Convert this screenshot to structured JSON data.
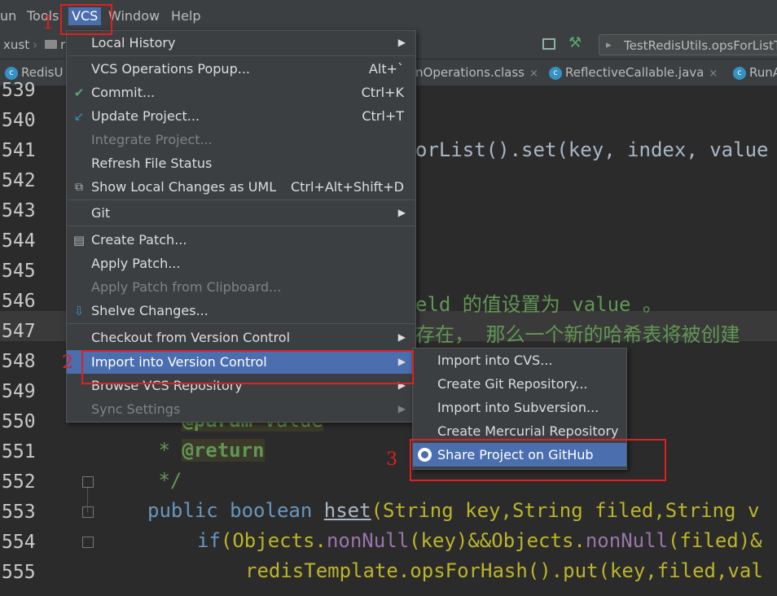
{
  "menubar": {
    "items": [
      "un",
      "Tools",
      "VCS",
      "Window",
      "Help"
    ]
  },
  "navbar": {
    "crumbs": [
      "xust",
      "r"
    ],
    "run_config": "TestRedisUtils.opsForListT"
  },
  "tabs": [
    {
      "label": "RedisU",
      "close": ""
    },
    {
      "label": "nOperations.class",
      "close": "×"
    },
    {
      "label": "ReflectiveCallable.java",
      "close": "×"
    },
    {
      "label": "RunA",
      "close": ""
    }
  ],
  "editor": {
    "line_numbers": [
      "539",
      "540",
      "541",
      "542",
      "543",
      "544",
      "545",
      "546",
      "547",
      "548",
      "549",
      "550",
      "551",
      "552",
      "553",
      "554",
      "555"
    ],
    "code": {
      "l541": "orList().set(key, index, value",
      "l546a": "eld ",
      "l546b": "的值设置为 ",
      "l546c": "value ",
      "l546d": "。",
      "l547": "存在， 那么一个新的哈希表将被创建",
      "l550_star": " * ",
      "l550_tag": "@param",
      "l550_val": " value",
      "l551_star": " * ",
      "l551_tag": "@return",
      "l552": " */",
      "l553_kw1": "public",
      "l553_kw2": "boolean",
      "l553_m": "hset",
      "l553_rest": "(String key,String filed,String v",
      "l554_kw": "if",
      "l554_rest1": "(Objects.",
      "l554_m1": "nonNull",
      "l554_rest2": "(key)&&Objects.",
      "l554_m2": "nonNull",
      "l554_rest3": "(filed)&",
      "l555_f": "redisTemplate",
      "l555_rest": ".opsForHash().put(key,filed,val"
    }
  },
  "vcs_menu": {
    "items": [
      {
        "label": "Local History",
        "shortcut": "",
        "arrow": true,
        "disabled": false,
        "icon": ""
      },
      {
        "label": "VCS Operations Popup...",
        "shortcut": "Alt+`",
        "arrow": false,
        "disabled": false,
        "icon": ""
      },
      {
        "label": "Commit...",
        "shortcut": "Ctrl+K",
        "arrow": false,
        "disabled": false,
        "icon": "check-icon"
      },
      {
        "label": "Update Project...",
        "shortcut": "Ctrl+T",
        "arrow": false,
        "disabled": false,
        "icon": "update-arrow-icon"
      },
      {
        "label": "Integrate Project...",
        "shortcut": "",
        "arrow": false,
        "disabled": true,
        "icon": ""
      },
      {
        "label": "Refresh File Status",
        "shortcut": "",
        "arrow": false,
        "disabled": false,
        "icon": ""
      },
      {
        "label": "Show Local Changes as UML",
        "shortcut": "Ctrl+Alt+Shift+D",
        "arrow": false,
        "disabled": false,
        "icon": "uml-icon"
      },
      {
        "label": "Git",
        "shortcut": "",
        "arrow": true,
        "disabled": false,
        "icon": ""
      },
      {
        "label": "Create Patch...",
        "shortcut": "",
        "arrow": false,
        "disabled": false,
        "icon": "patch-icon"
      },
      {
        "label": "Apply Patch...",
        "shortcut": "",
        "arrow": false,
        "disabled": false,
        "icon": ""
      },
      {
        "label": "Apply Patch from Clipboard...",
        "shortcut": "",
        "arrow": false,
        "disabled": true,
        "icon": ""
      },
      {
        "label": "Shelve Changes...",
        "shortcut": "",
        "arrow": false,
        "disabled": false,
        "icon": "shelve-icon"
      },
      {
        "label": "Checkout from Version Control",
        "shortcut": "",
        "arrow": true,
        "disabled": false,
        "icon": ""
      },
      {
        "label": "Import into Version Control",
        "shortcut": "",
        "arrow": true,
        "disabled": false,
        "icon": "",
        "selected": true
      },
      {
        "label": "Browse VCS Repository",
        "shortcut": "",
        "arrow": true,
        "disabled": false,
        "icon": ""
      },
      {
        "label": "Sync Settings",
        "shortcut": "",
        "arrow": true,
        "disabled": true,
        "icon": ""
      }
    ]
  },
  "sub_menu": {
    "items": [
      {
        "label": "Import into CVS..."
      },
      {
        "label": "Create Git Repository..."
      },
      {
        "label": "Import into Subversion..."
      },
      {
        "label": "Create Mercurial Repository"
      },
      {
        "label": "Share Project on GitHub",
        "selected": true,
        "icon": "github-icon"
      }
    ]
  },
  "annotations": {
    "n1": "1",
    "n2": "2",
    "n3": "3",
    "color": "#e02020"
  },
  "colors": {
    "selection": "#4b6eaf",
    "menu_bg": "#3c3f41",
    "editor_bg": "#2b2b2b"
  }
}
